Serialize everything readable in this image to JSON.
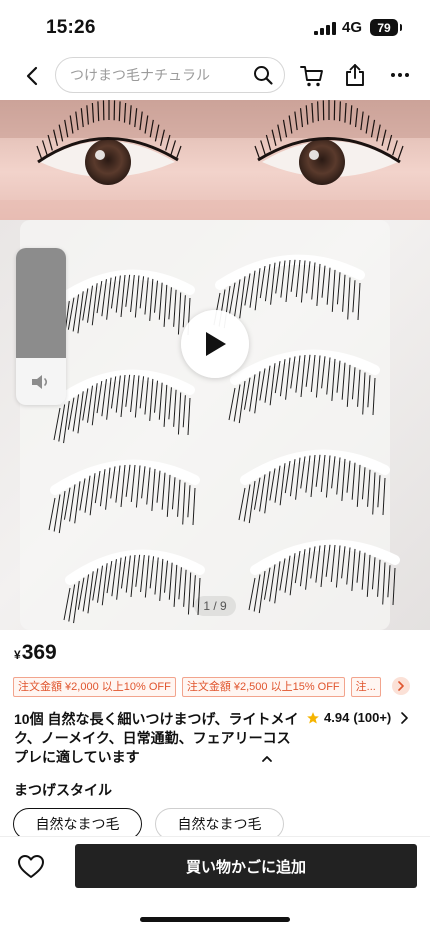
{
  "status_bar": {
    "time": "15:26",
    "network": "4G",
    "battery": "79"
  },
  "nav": {
    "search_placeholder": "つけまつ毛ナチュラル",
    "icons": [
      "back-arrow-icon",
      "search-icon",
      "cart-icon",
      "share-icon",
      "more-icon"
    ]
  },
  "media": {
    "page_indicator": "1 / 9",
    "volume_level": 0.7
  },
  "product": {
    "currency": "¥",
    "price": "369",
    "coupons": [
      "注文金額 ¥2,000 以上10% OFF",
      "注文金額 ¥2,500 以上15% OFF",
      "注..."
    ],
    "title": "10個 自然な長く細いつけまつげ、ライトメイク、ノーメイク、日常通勤、フェアリーコスプレに適しています",
    "rating_score": "4.94",
    "rating_count": "(100+)"
  },
  "style": {
    "label": "まつげスタイル",
    "options": [
      "自然なまつ毛",
      "自然なまつ毛"
    ],
    "selected_index": 0
  },
  "bottom": {
    "add_to_cart": "買い物かごに追加"
  },
  "colors": {
    "accent": "#e0552e",
    "button_dark": "#222222",
    "star": "#f5b400"
  }
}
